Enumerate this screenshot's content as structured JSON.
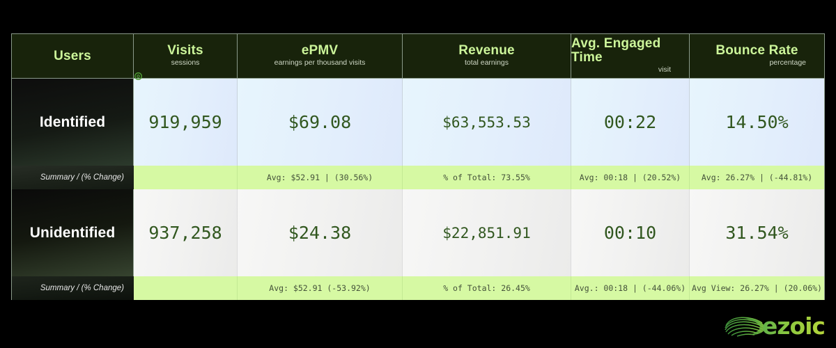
{
  "table": {
    "columns": [
      {
        "key": "users",
        "title": "Users",
        "subtitle": ""
      },
      {
        "key": "visits",
        "title": "Visits",
        "subtitle": "sessions"
      },
      {
        "key": "epmv",
        "title": "ePMV",
        "subtitle": "earnings per thousand visits"
      },
      {
        "key": "rev",
        "title": "Revenue",
        "subtitle": "total earnings"
      },
      {
        "key": "time",
        "title": "Avg. Engaged Time",
        "subtitle": "visit"
      },
      {
        "key": "bounce",
        "title": "Bounce Rate",
        "subtitle": "percentage"
      }
    ],
    "rows": [
      {
        "label": "Identified",
        "badge_icon": "verified-circle-icon",
        "visits": "919,959",
        "epmv": "$69.08",
        "revenue": "$63,553.53",
        "engaged_time": "00:22",
        "bounce_rate": "14.50%",
        "summary": {
          "label": "Summary / (% Change)",
          "epmv": "Avg: $52.91 | (30.56%)",
          "revenue": "% of Total: 73.55%",
          "engaged_time": "Avg: 00:18 | (20.52%)",
          "bounce_rate": "Avg: 26.27% | (-44.81%)"
        }
      },
      {
        "label": "Unidentified",
        "badge_icon": "",
        "visits": "937,258",
        "epmv": "$24.38",
        "revenue": "$22,851.91",
        "engaged_time": "00:10",
        "bounce_rate": "31.54%",
        "summary": {
          "label": "Summary / (% Change)",
          "epmv": "Avg: $52.91 (-53.92%)",
          "revenue": "% of Total: 26.45%",
          "engaged_time": "Avg.: 00:18 | (-44.06%)",
          "bounce_rate": "Avg View: 26.27% | (20.06%)"
        }
      }
    ]
  },
  "branding": {
    "logo_text": "ezoic",
    "logo_mark_icon": "ezoic-swirl-icon"
  },
  "colors": {
    "header_bg": "#18230b",
    "header_text": "#ccf59a",
    "summary_bg": "#d6f9a3",
    "metric_text": "#31571f",
    "identified_cell": "#e3effc",
    "unidentified_cell": "#f1f1f0",
    "brand_green": "#8fc93f"
  }
}
